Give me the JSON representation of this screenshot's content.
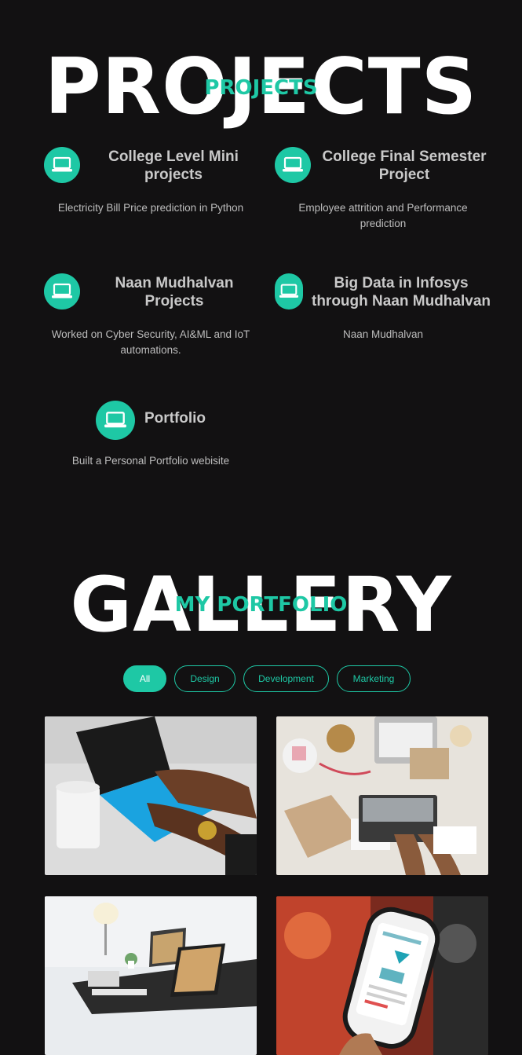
{
  "projects_section": {
    "bg_title": "PROJECTS",
    "overlay_title": "PROJECTS",
    "items": [
      {
        "title_line1": "College Level Mini",
        "title_line2": "projects",
        "desc_line1": "Electricity Bill Price prediction in Python",
        "desc_line2": "",
        "icon": "laptop-icon"
      },
      {
        "title_line1": "College Final Semester",
        "title_line2": "Project",
        "desc_line1": "Employee attrition and Performance",
        "desc_line2": "prediction",
        "icon": "laptop-icon"
      },
      {
        "title_line1": "Naan Mudhalvan",
        "title_line2": "Projects",
        "desc_line1": "Worked on Cyber Security, AI&ML and IoT",
        "desc_line2": "automations.",
        "icon": "laptop-icon"
      },
      {
        "title_line1": "Big Data in Infosys",
        "title_line2": "through Naan Mudhalvan",
        "desc_line1": "Naan Mudhalvan",
        "desc_line2": "",
        "icon": "laptop-icon"
      },
      {
        "title_line1": "Portfolio",
        "title_line2": "",
        "desc_line1": "Built a Personal Portfolio webisite",
        "desc_line2": "",
        "icon": "laptop-icon"
      }
    ]
  },
  "gallery_section": {
    "bg_title": "GALLERY",
    "overlay_title": "MY PORTFOLIO",
    "filters": [
      "All",
      "Design",
      "Development",
      "Marketing"
    ],
    "active_filter": "All"
  },
  "colors": {
    "accent": "#1ec8a5",
    "background": "#121112"
  }
}
